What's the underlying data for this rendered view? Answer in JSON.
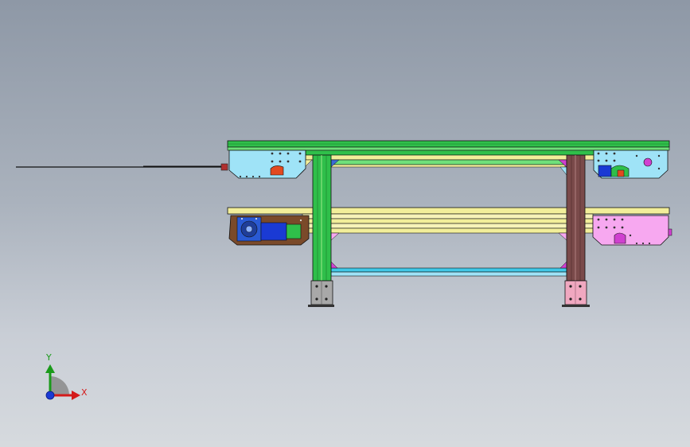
{
  "viewport": {
    "background_top": "#8e98a6",
    "background_bottom": "#d6dade"
  },
  "triad": {
    "x_label": "X",
    "y_label": "Y",
    "x_color": "#d41a1a",
    "y_color": "#1a9a1a",
    "z_color": "#1a3ad4"
  },
  "colors": {
    "frame_green": "#2fbf4a",
    "rail_yellow": "#f2ee9a",
    "rail_cyan": "#3fc7e6",
    "leg_brown": "#7a4a4a",
    "head_cyan": "#9fe3f7",
    "head_pink": "#f7a8f0",
    "motor_blue": "#1a3ad4",
    "gearbox_brown": "#7a4a2a"
  }
}
